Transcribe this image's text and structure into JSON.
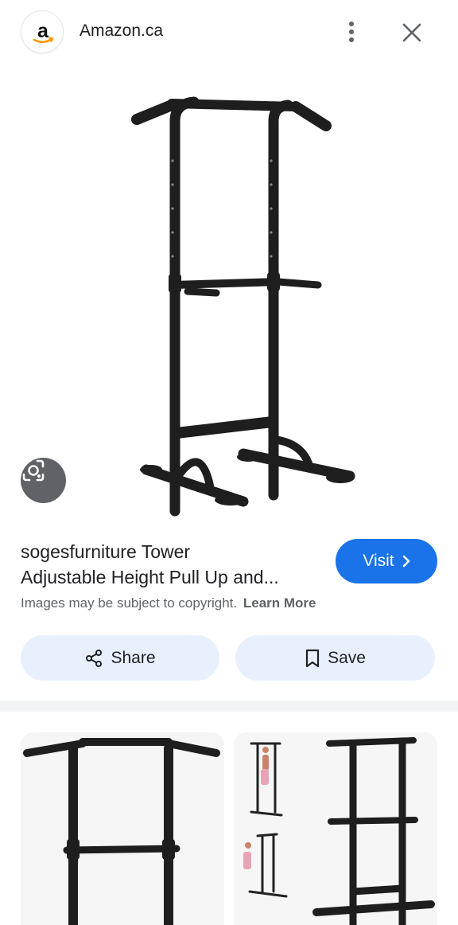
{
  "header": {
    "site_name": "Amazon.ca",
    "favicon_icon": "amazon-logo-icon",
    "more_icon": "more-vert-icon",
    "close_icon": "close-icon"
  },
  "hero": {
    "image_icon": "power-tower-pull-up-station-image",
    "lens_icon": "google-lens-icon"
  },
  "result": {
    "title_line1": "sogesfurniture Tower",
    "title_line2": "Adjustable Height Pull Up and...",
    "visit_label": "Visit",
    "copyright_text": "Images may be subject to copyright.",
    "learn_more": "Learn More"
  },
  "actions": {
    "share_label": "Share",
    "save_label": "Save"
  },
  "colors": {
    "accent": "#1a73e8",
    "pill_bg": "#e8f0fe",
    "lens_bg": "#5f6368"
  }
}
